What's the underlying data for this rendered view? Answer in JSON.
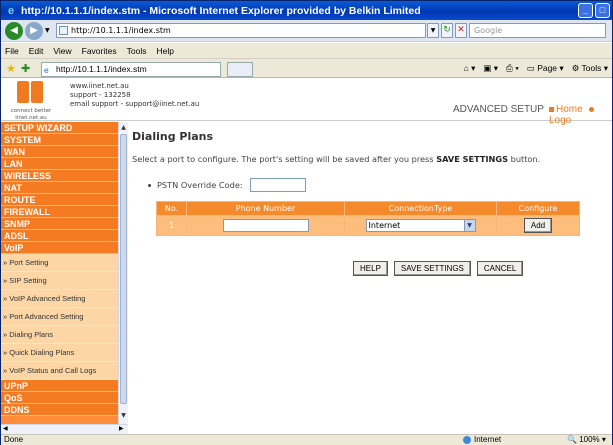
{
  "window": {
    "title": "http://10.1.1.1/index.stm - Microsoft Internet Explorer provided by Belkin Limited",
    "minimize_icon": "minimize-icon",
    "maximize_icon": "maximize-icon"
  },
  "address_bar": {
    "url": "http://10.1.1.1/index.stm",
    "search_placeholder": "Google"
  },
  "menu": [
    "File",
    "Edit",
    "View",
    "Favorites",
    "Tools",
    "Help"
  ],
  "favorites_bar": {
    "tab_label": "http://10.1.1.1/index.stm",
    "page_label": "Page",
    "tools_label": "Tools"
  },
  "router": {
    "tagline": "connect better",
    "tagline_url": "iinet.net.au",
    "contact_line1": "www.iinet.net.au",
    "contact_line2": "support - 132258",
    "contact_line3": "email support - support@iinet.net.au",
    "advanced_setup": "ADVANCED SETUP",
    "home_link": "Home",
    "logout_link": "Logo"
  },
  "sidebar": {
    "sections_top": [
      "SETUP WIZARD",
      "SYSTEM",
      "WAN",
      "LAN",
      "WIRELESS",
      "NAT",
      "ROUTE",
      "FIREWALL",
      "SNMP",
      "ADSL",
      "VoIP"
    ],
    "voip_items": [
      "» Port Setting",
      "» SIP Setting",
      "» VoIP Advanced Setting",
      "» Port Advanced Setting",
      "» Dialing Plans",
      "» Quick Dialing Plans",
      "» VoIP Status and Call Logs"
    ],
    "sections_bottom": [
      "UPnP",
      "QoS",
      "DDNS"
    ]
  },
  "main": {
    "title": "Dialing Plans",
    "instruction_pre": "Select a port to configure. The port's setting will be saved after you press ",
    "instruction_bold": "SAVE SETTINGS",
    "instruction_post": " button.",
    "pstn_label": "PSTN Override Code:",
    "pstn_value": "",
    "table": {
      "headers": [
        "No.",
        "Phone Number",
        "ConnectionType",
        "Configure"
      ],
      "row": {
        "no": "1",
        "phone": "",
        "connection_type": "Internet",
        "configure_button": "Add"
      }
    },
    "buttons": {
      "help": "HELP",
      "save": "SAVE SETTINGS",
      "cancel": "CANCEL"
    }
  },
  "statusbar": {
    "status": "Done",
    "zone": "Internet",
    "zoom": "100%"
  },
  "colors": {
    "accent": "#f47b22",
    "submenu": "#fdd6a6",
    "table_header": "#f58a2c",
    "table_row": "#fdbd7c"
  }
}
